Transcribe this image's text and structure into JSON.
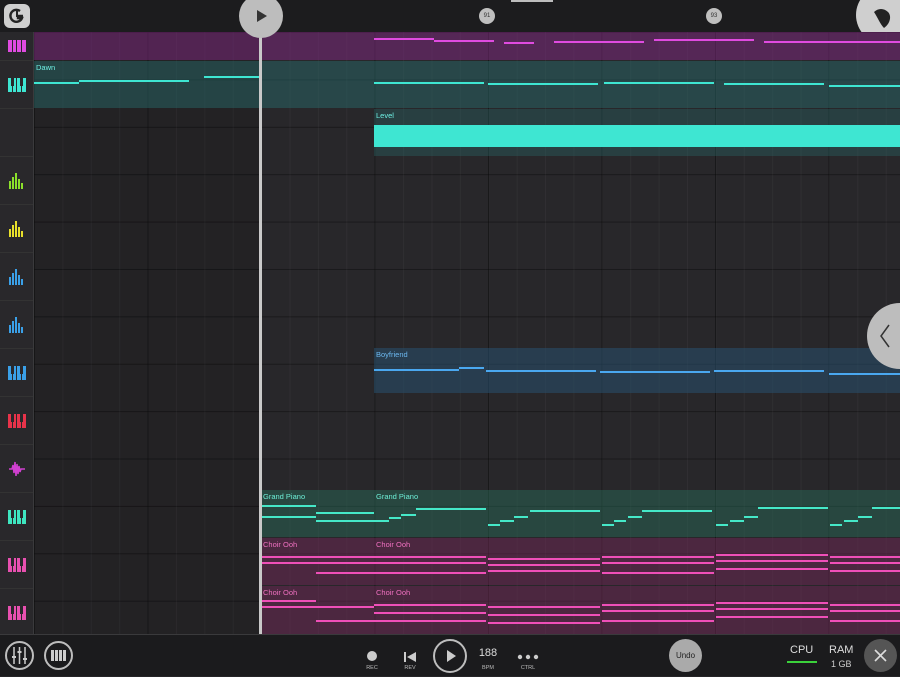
{
  "ruler": {
    "markers": [
      {
        "label": "91"
      },
      {
        "label": "93"
      }
    ]
  },
  "clips": {
    "dawn": "Dawn",
    "level": "Level",
    "boyfriend": "Boyfriend",
    "grand_piano_1": "Grand Piano",
    "grand_piano_2": "Grand Piano",
    "choir_ooh_1": "Choir Ooh",
    "choir_ooh_2": "Choir Ooh",
    "choir_ooh_3": "Choir Ooh",
    "choir_ooh_4": "Choir Ooh"
  },
  "tracks": [
    {
      "icon": "piano-keys-icon",
      "color": "#e04be0"
    },
    {
      "icon": "piano-keys-icon",
      "color": "#3ee6d2"
    },
    {
      "icon": "automation-track",
      "color": "#000000"
    },
    {
      "icon": "drum-bars-icon",
      "color": "#8be02b"
    },
    {
      "icon": "drum-bars-icon",
      "color": "#e8e02b"
    },
    {
      "icon": "drum-bars-icon",
      "color": "#3aa0e8"
    },
    {
      "icon": "drum-bars-icon",
      "color": "#3aa0e8"
    },
    {
      "icon": "piano-keys-icon",
      "color": "#3aa0e8"
    },
    {
      "icon": "piano-keys-icon",
      "color": "#e8334a"
    },
    {
      "icon": "waveform-icon",
      "color": "#d040d0"
    },
    {
      "icon": "piano-keys-icon",
      "color": "#3ee6c0"
    },
    {
      "icon": "piano-keys-icon",
      "color": "#e850b0"
    },
    {
      "icon": "piano-keys-icon",
      "color": "#e850b0"
    }
  ],
  "toolbar": {
    "rec_label": "REC",
    "rev_label": "REV",
    "bpm_value": "188",
    "bpm_label": "BPM",
    "ctrl_label": "CTRL",
    "undo_label": "Undo",
    "cpu_label": "CPU",
    "ram_label": "RAM",
    "ram_value": "1 GB"
  },
  "colors": {
    "teal": "#3ee6d2",
    "magenta": "#e04be0",
    "blue": "#4aa8f0",
    "pink": "#ef4fb8",
    "mint": "#45e8c8",
    "cpu_meter": "#3bd13b"
  }
}
